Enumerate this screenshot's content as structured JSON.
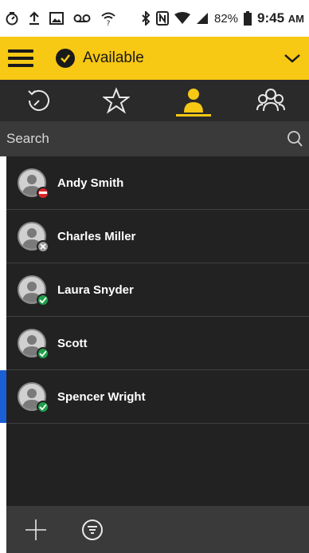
{
  "status_bar": {
    "battery_percent": "82%",
    "time": "9:45",
    "ampm": "AM"
  },
  "header": {
    "presence_status": "Available"
  },
  "tabs": [
    {
      "name": "recent",
      "icon": "history-icon",
      "active": false
    },
    {
      "name": "favorites",
      "icon": "star-icon",
      "active": false
    },
    {
      "name": "contacts",
      "icon": "person-icon",
      "active": true
    },
    {
      "name": "groups",
      "icon": "group-icon",
      "active": false
    }
  ],
  "search": {
    "placeholder": "Search",
    "value": ""
  },
  "contacts": [
    {
      "name": "Andy Smith",
      "presence": "busy"
    },
    {
      "name": "Charles Miller",
      "presence": "offline"
    },
    {
      "name": "Laura Snyder",
      "presence": "available"
    },
    {
      "name": "Scott",
      "presence": "available"
    },
    {
      "name": "Spencer Wright",
      "presence": "available",
      "selected": true
    }
  ],
  "colors": {
    "accent": "#f7c814",
    "selected_indicator": "#1a5fd6",
    "busy": "#d8262b",
    "available": "#1ea04a",
    "offline": "#9a9a9a"
  },
  "bottom_bar": {
    "actions": [
      "add-icon",
      "filter-icon"
    ]
  }
}
